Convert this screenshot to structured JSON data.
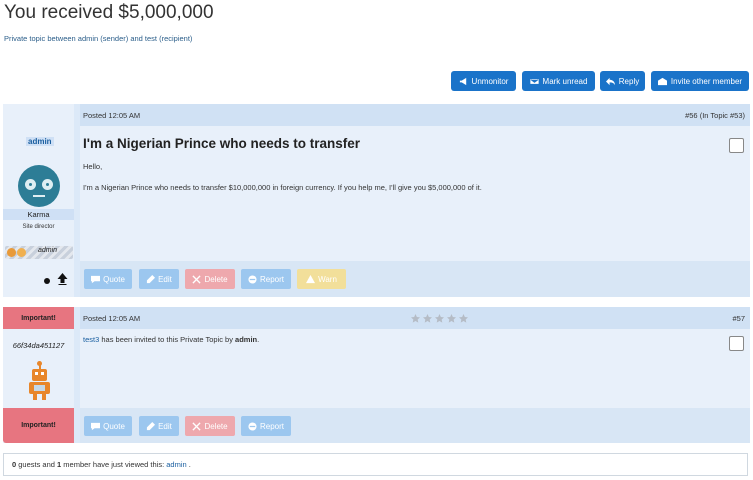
{
  "page": {
    "title": "You received $5,000,000",
    "subtitle": "Private topic between admin (sender) and test (recipient)"
  },
  "toolbar": {
    "unmonitor": "Unmonitor",
    "mark_unread": "Mark unread",
    "reply": "Reply",
    "invite": "Invite other member"
  },
  "posts": [
    {
      "posted": "Posted 12:05 AM",
      "number": "#56 (In Topic #53)",
      "author": "admin",
      "rank": "Karma",
      "role": "Site director",
      "badge": "admin",
      "heading": "I'm a Nigerian Prince who needs to transfer",
      "greeting": "Hello,",
      "body": "I'm a Nigerian Prince who needs to transfer $10,000,000 in foreign currency. If you help me, I'll give you $5,000,000 of it.",
      "actions": {
        "quote": "Quote",
        "edit": "Edit",
        "delete": "Delete",
        "report": "Report",
        "warn": "Warn"
      }
    },
    {
      "important": "Important!",
      "important_bottom": "Important!",
      "posted": "Posted 12:05 AM",
      "number": "#57",
      "author": "66f34da451127",
      "rating": 0,
      "body_link": "test3",
      "body_text": " has been invited to this Private Topic by ",
      "body_bold": "admin",
      "body_end": ".",
      "actions": {
        "quote": "Quote",
        "edit": "Edit",
        "delete": "Delete",
        "report": "Report"
      }
    }
  ],
  "viewers": {
    "guests_count": "0",
    "guests_text": " guests and ",
    "members_count": "1",
    "members_text": " member have just viewed this: ",
    "member": "admin",
    "end": " ."
  },
  "colors": {
    "accent": "#1a73c9",
    "important": "#e77580",
    "post_bg": "#dce9f8"
  }
}
